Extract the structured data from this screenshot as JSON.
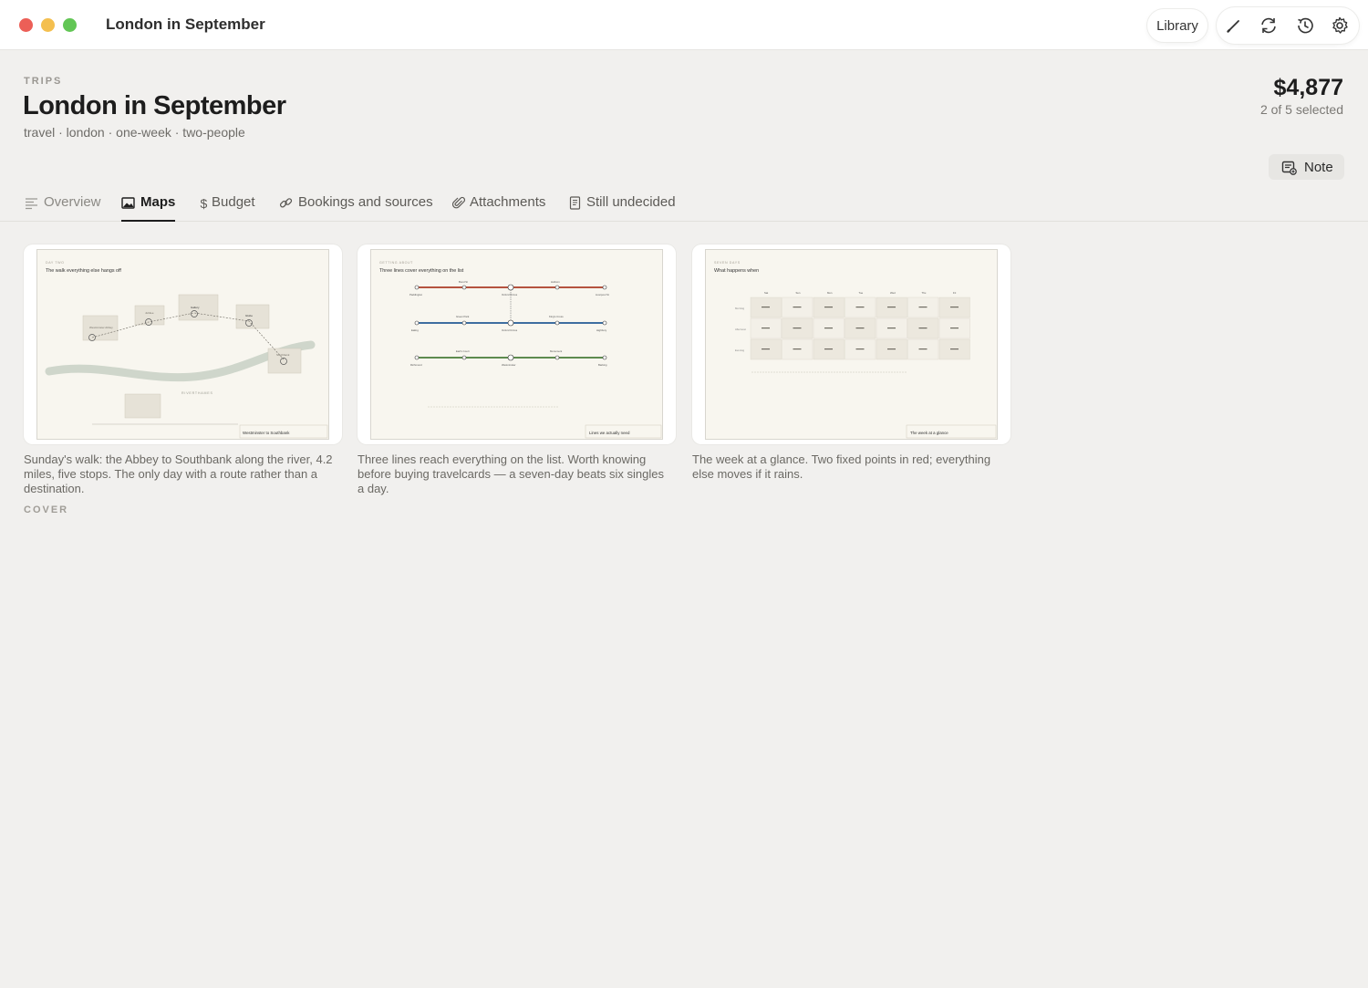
{
  "window": {
    "title": "London in September",
    "library_label": "Library",
    "tool_icons": [
      "pencil-icon",
      "refresh-icon",
      "history-icon",
      "gear-icon"
    ]
  },
  "header": {
    "eyebrow": "TRIPS",
    "title": "London in September",
    "tags": "travel · london · one-week · two-people",
    "total": "$4,877",
    "selected": "2 of 5 selected",
    "note_label": "Note"
  },
  "tabs": [
    {
      "label": "Overview",
      "icon": "list-icon"
    },
    {
      "label": "Maps",
      "icon": "image-icon",
      "active": true
    },
    {
      "label": "Budget",
      "icon": "dollar-icon"
    },
    {
      "label": "Bookings and sources",
      "icon": "link-icon"
    },
    {
      "label": "Attachments",
      "icon": "paperclip-icon"
    },
    {
      "label": "Still undecided",
      "icon": "document-icon"
    }
  ],
  "cards": [
    {
      "eyebrow": "DAY TWO",
      "heading": "The walk everything else hangs off",
      "river_label": "RIVERTHAMES",
      "stamp_label": "Westminster to Southbank",
      "stops": [
        "Westminster Abbey",
        "Jubilee",
        "Gallery",
        "Globe",
        "Southbank"
      ],
      "caption": "Sunday's walk: the Abbey to Southbank along the river, 4.2 miles, five stops. The only day with a route rather than a destination.",
      "badge": "COVER"
    },
    {
      "eyebrow": "GETTING ABOUT",
      "heading": "Three lines cover everything on the list",
      "stamp_label": "Lines we actually need",
      "stations_top": [
        "Paddington",
        "Bond St",
        "Oxford Circus",
        "Holborn",
        "Liverpool St"
      ],
      "stations_mid": [
        "Ealing",
        "Green Park",
        "Oxford Circus",
        "King's Cross",
        "Highbury"
      ],
      "stations_bot": [
        "Richmond",
        "Earl's Court",
        "Westminster",
        "Monument",
        "Barking"
      ],
      "caption": "Three lines reach everything on the list. Worth knowing before buying travelcards — a seven-day beats six singles a day."
    },
    {
      "eyebrow": "SEVEN DAYS",
      "heading": "What happens when",
      "stamp_label": "The week at a glance",
      "days": [
        "Sat",
        "Sun",
        "Mon",
        "Tue",
        "Wed",
        "Thu",
        "Fri"
      ],
      "rows": [
        "Morning",
        "Afternoon",
        "Evening"
      ],
      "caption": "The week at a glance. Two fixed points in red; everything else moves if it rains."
    }
  ],
  "colors": {
    "line_red": "#b5533f",
    "line_blue": "#3e6ea0",
    "line_green": "#5d8b4f",
    "river": "#cfd6cb",
    "fixed_red": "#c0392b"
  }
}
